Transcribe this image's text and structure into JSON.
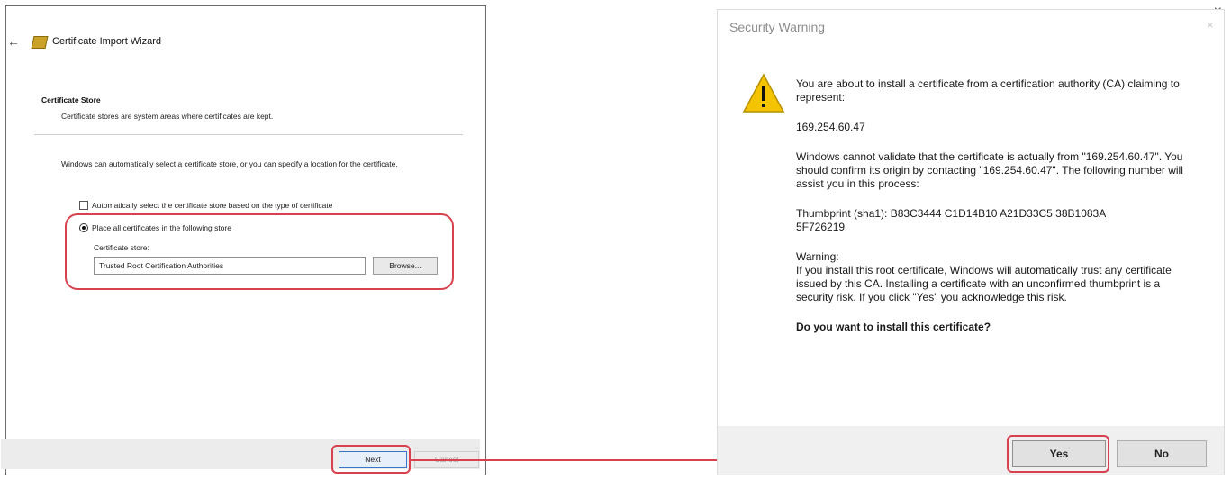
{
  "wizard": {
    "close_glyph": "×",
    "back_glyph": "←",
    "title": "Certificate Import Wizard",
    "section_title": "Certificate Store",
    "section_subtitle": "Certificate stores are system areas where certificates are kept.",
    "description": "Windows can automatically select a certificate store, or you can specify a location for the certificate.",
    "option_auto_label": "Automatically select the certificate store based on the type of certificate",
    "option_auto_selected": false,
    "option_place_label": "Place all certificates in the following store",
    "option_place_selected": true,
    "store_label": "Certificate store:",
    "store_value": "Trusted Root Certification Authorities",
    "browse_label": "Browse...",
    "next_label": "Next",
    "cancel_label": "Cancel"
  },
  "security_warning": {
    "title": "Security Warning",
    "close_glyph": "×",
    "icon": "warning-triangle-icon",
    "intro": "You are about to install a certificate from a certification authority (CA) claiming to represent:",
    "ip": "169.254.60.47",
    "validation_text": "Windows cannot validate that the certificate is actually from \"169.254.60.47\". You should confirm its origin by contacting \"169.254.60.47\". The following number will assist you in this process:",
    "thumbprint_line1": "Thumbprint (sha1): B83C3444 C1D14B10 A21D33C5 38B1083A",
    "thumbprint_line2": "5F726219",
    "warning_heading": "Warning:",
    "warning_text": "If you install this root certificate, Windows will automatically trust any certificate issued by this CA. Installing a certificate with an unconfirmed thumbprint is a security risk. If you click \"Yes\" you acknowledge this risk.",
    "question": "Do you want to install this certificate?",
    "yes_label": "Yes",
    "no_label": "No"
  },
  "colors": {
    "highlight": "#d8414f",
    "warning_yellow": "#f5c400"
  }
}
